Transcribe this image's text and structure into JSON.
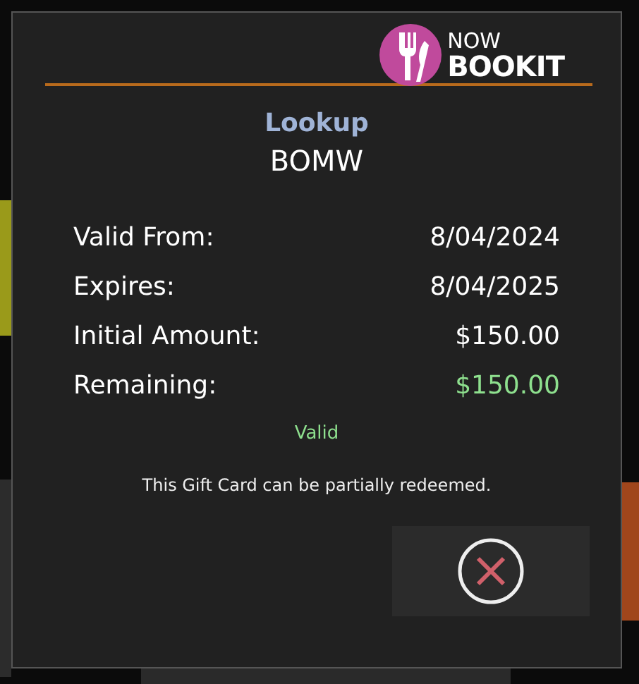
{
  "logo": {
    "top": "NOW",
    "bottom": "BOOKIT"
  },
  "heading": "Lookup",
  "code": "BOMW",
  "details": [
    {
      "label": "Valid From:",
      "value": "8/04/2024",
      "kind": "plain"
    },
    {
      "label": "Expires:",
      "value": "8/04/2025",
      "kind": "plain"
    },
    {
      "label": "Initial Amount:",
      "value": "$150.00",
      "kind": "plain"
    },
    {
      "label": "Remaining:",
      "value": "$150.00",
      "kind": "positive"
    }
  ],
  "status": {
    "text": "Valid",
    "kind": "valid"
  },
  "note": "This Gift Card can be partially redeemed.",
  "buttons": [
    {
      "kind": "close"
    }
  ]
}
